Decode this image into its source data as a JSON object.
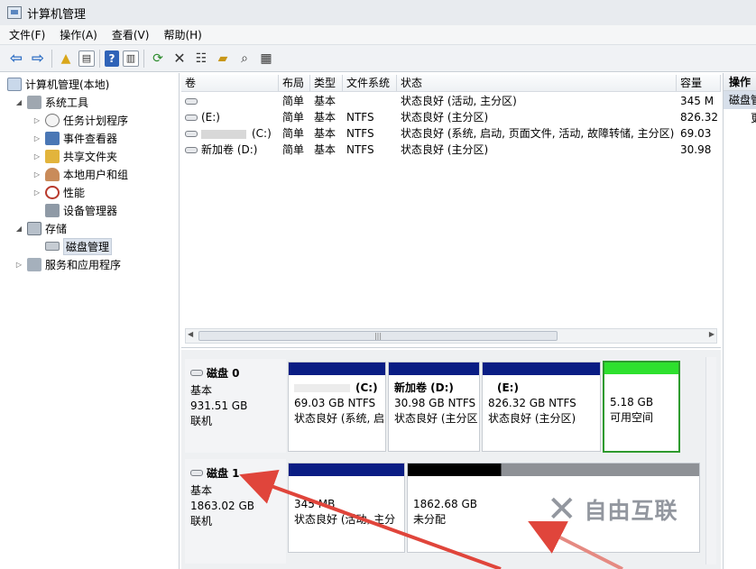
{
  "window": {
    "title": "计算机管理"
  },
  "menu": [
    "文件(F)",
    "操作(A)",
    "查看(V)",
    "帮助(H)"
  ],
  "toolbar": {
    "icons": [
      "back-arrow-icon",
      "forward-arrow-icon",
      "up-folder-icon",
      "show-hide-tree-icon",
      "help-icon",
      "show-hide-action-icon",
      "refresh-icon",
      "delete-icon",
      "properties-icon",
      "open-icon",
      "search-icon",
      "export-icon"
    ]
  },
  "tree": {
    "root": "计算机管理(本地)",
    "system_tools": "系统工具",
    "task_scheduler": "任务计划程序",
    "event_viewer": "事件查看器",
    "shared_folders": "共享文件夹",
    "local_users": "本地用户和组",
    "performance": "性能",
    "device_manager": "设备管理器",
    "storage": "存储",
    "disk_management": "磁盘管理",
    "services_apps": "服务和应用程序"
  },
  "volumes": {
    "headers": [
      "卷",
      "布局",
      "类型",
      "文件系统",
      "状态",
      "容量"
    ],
    "rows": [
      {
        "vol": "",
        "layout": "简单",
        "type": "基本",
        "fs": "",
        "status": "状态良好 (活动, 主分区)",
        "cap": "345 M"
      },
      {
        "vol": "(E:)",
        "layout": "简单",
        "type": "基本",
        "fs": "NTFS",
        "status": "状态良好 (主分区)",
        "cap": "826.32"
      },
      {
        "vol": "(C:)",
        "layout": "简单",
        "type": "基本",
        "fs": "NTFS",
        "status": "状态良好 (系统, 启动, 页面文件, 活动, 故障转储, 主分区)",
        "cap": "69.03"
      },
      {
        "vol": "新加卷 (D:)",
        "layout": "简单",
        "type": "基本",
        "fs": "NTFS",
        "status": "状态良好 (主分区)",
        "cap": "30.98"
      }
    ]
  },
  "disks": [
    {
      "name": "磁盘 0",
      "kind": "基本",
      "size": "931.51 GB",
      "state": "联机",
      "partitions": [
        {
          "title": "(C:)",
          "size": "69.03 GB NTFS",
          "status": "状态良好 (系统, 启"
        },
        {
          "title": "新加卷 (D:)",
          "size": "30.98 GB NTFS",
          "status": "状态良好 (主分区"
        },
        {
          "title": "(E:)",
          "size": "826.32 GB NTFS",
          "status": "状态良好 (主分区)"
        },
        {
          "title": "",
          "size": "5.18 GB",
          "status": "可用空间"
        }
      ]
    },
    {
      "name": "磁盘 1",
      "kind": "基本",
      "size": "1863.02 GB",
      "state": "联机",
      "partitions": [
        {
          "title": "",
          "size": "345 MB",
          "status": "状态良好 (活动, 主分"
        },
        {
          "title": "",
          "size": "1862.68 GB",
          "status": "未分配"
        }
      ]
    }
  ],
  "actions": {
    "header": "操作",
    "item": "磁盘管",
    "more": "更"
  },
  "watermark": {
    "text": "自由互联"
  }
}
